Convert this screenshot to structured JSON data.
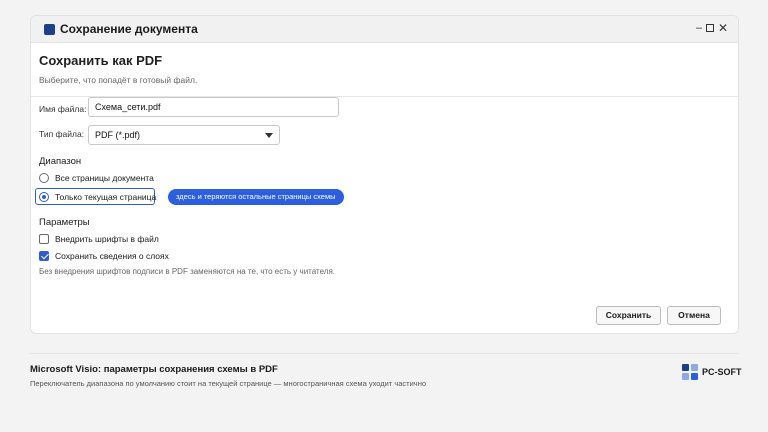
{
  "window": {
    "title": "Сохранение документа",
    "controls": {
      "minimize": "–",
      "close": "✕"
    }
  },
  "header": {
    "title": "Сохранить как PDF",
    "subtitle": "Выберите, что попадёт в готовый файл."
  },
  "file": {
    "name_label": "Имя файла:",
    "name_value": "Схема_сети.pdf",
    "type_label": "Тип файла:",
    "type_value": "PDF (*.pdf)"
  },
  "range": {
    "title": "Диапазон",
    "options": [
      {
        "label": "Все страницы документа",
        "selected": false
      },
      {
        "label": "Только текущая страница",
        "selected": true
      }
    ],
    "tooltip": "здесь и теряются остальные страницы схемы"
  },
  "params": {
    "title": "Параметры",
    "options": [
      {
        "label": "Внедрить шрифты в файл",
        "checked": false
      },
      {
        "label": "Сохранить сведения о слоях",
        "checked": true
      }
    ],
    "hint": "Без внедрения шрифтов подписи в PDF заменяются на те, что есть у читателя."
  },
  "buttons": {
    "save": "Сохранить",
    "cancel": "Отмена"
  },
  "caption": {
    "title": "Microsoft Visio: параметры сохранения схемы в PDF",
    "subtitle": "Переключатель диапазона по умолчанию стоит на текущей странице — многостраничная схема уходит частично"
  },
  "brand": {
    "name": "PC-SOFT",
    "colors": {
      "primary": "#1e3f8a",
      "accent": "#2c5fe0",
      "light": "#8fa9e8"
    }
  },
  "icons": [
    "app-window-icon",
    "minimize-icon",
    "maximize-icon",
    "close-icon",
    "dropdown-caret-icon",
    "checkmark-icon",
    "pc-soft-logo-icon"
  ]
}
